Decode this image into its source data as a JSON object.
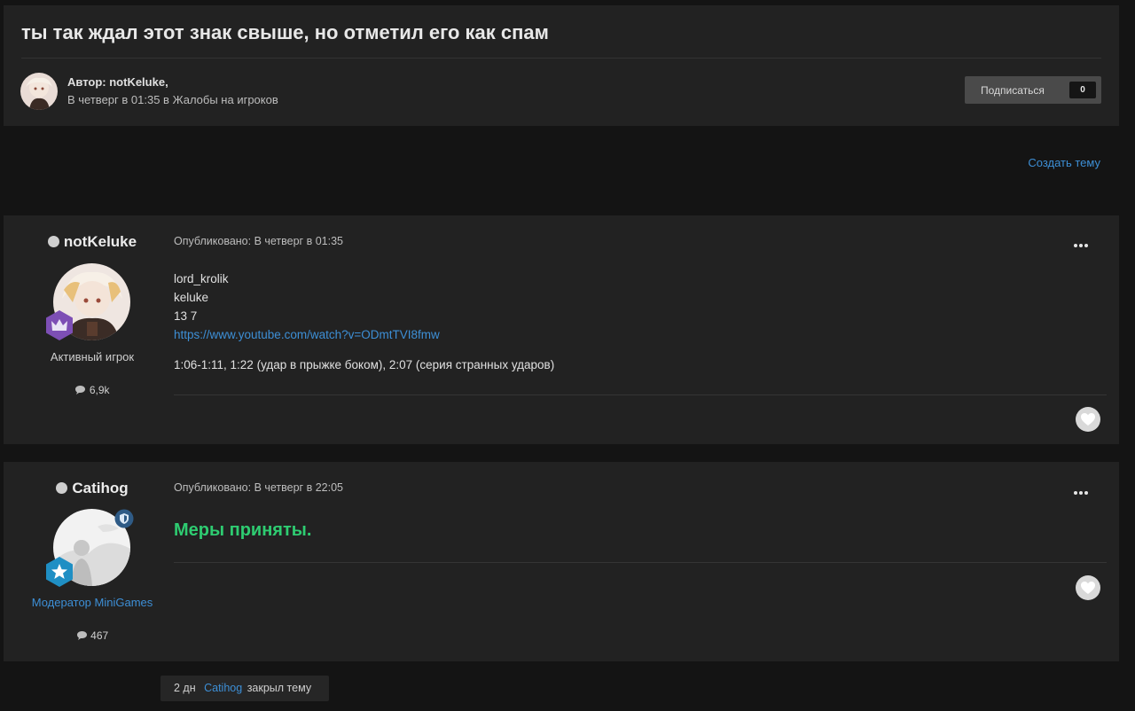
{
  "topic": {
    "title": "ты так ждал этот знак свыше, но отметил его как спам",
    "author_line": "Автор: notKeluke,",
    "sub_prefix": "В четверг в 01:35 в ",
    "forum": "Жалобы на игроков",
    "subscribe_label": "Подписаться",
    "subscribe_count": "0"
  },
  "actions": {
    "create_topic": "Создать тему"
  },
  "posts": [
    {
      "username": "notKeluke",
      "user_title": "Активный игрок",
      "post_count": "6,9k",
      "meta": "Опубликовано: В четверг в 01:35",
      "lines": [
        "lord_krolik",
        "keluke",
        "13 7"
      ],
      "link": "https://www.youtube.com/watch?v=ODmtTVI8fmw",
      "note": "1:06-1:11, 1:22 (удар в прыжке боком), 2:07 (серия странных ударов)"
    },
    {
      "username": "Catihog",
      "user_title": "Модератор MiniGames",
      "post_count": "467",
      "meta": "Опубликовано: В четверг в 22:05",
      "message": "Меры приняты."
    }
  ],
  "event": {
    "time": "2 дн",
    "user": "Catihog",
    "action": "закрыл тему"
  },
  "colors": {
    "accent": "#3d8fd6",
    "success": "#2ecc71",
    "moderator": "#3d8fd6",
    "background": "#141414",
    "panel": "#222222"
  },
  "icons": [
    "more-options-icon",
    "like-heart-icon",
    "comment-bubble-icon",
    "crown-rank-icon",
    "star-rank-icon",
    "moderator-shield-icon"
  ]
}
